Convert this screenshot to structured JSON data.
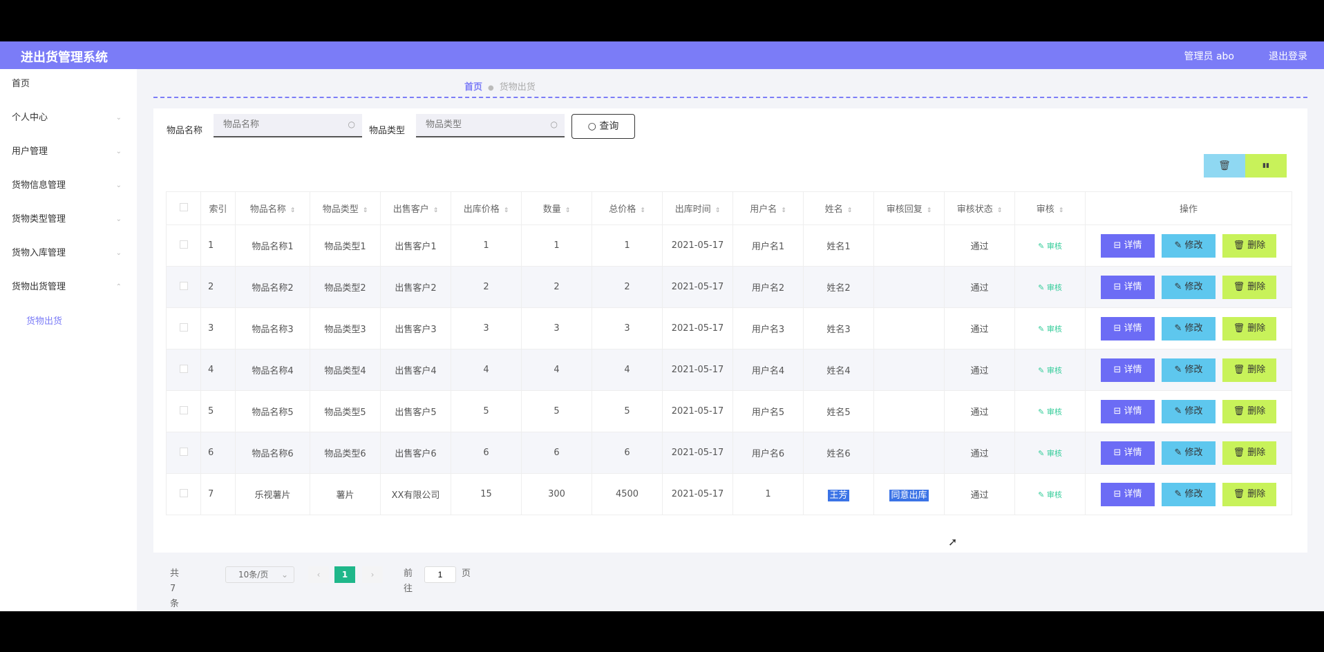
{
  "app": {
    "title": "进出货管理系统",
    "user_label": "管理员 abo",
    "logout_label": "退出登录"
  },
  "sidebar": {
    "items": [
      {
        "label": "首页",
        "chevron": ""
      },
      {
        "label": "个人中心",
        "chevron": "⌄"
      },
      {
        "label": "用户管理",
        "chevron": "⌄"
      },
      {
        "label": "货物信息管理",
        "chevron": "⌄"
      },
      {
        "label": "货物类型管理",
        "chevron": "⌄"
      },
      {
        "label": "货物入库管理",
        "chevron": "⌄"
      },
      {
        "label": "货物出货管理",
        "chevron": "⌃"
      }
    ],
    "sub_item": "货物出货"
  },
  "breadcrumb": {
    "home": "首页",
    "separator": "●",
    "current": "货物出货"
  },
  "search": {
    "name_label": "物品名称",
    "name_placeholder": "物品名称",
    "type_label": "物品类型",
    "type_placeholder": "物品类型",
    "query_label": "查询",
    "query_icon": "search-icon"
  },
  "toolbar": {
    "delete_icon": "🗑",
    "chart_icon": "▮▮"
  },
  "table": {
    "headers": [
      "索引",
      "物品名称",
      "物品类型",
      "出售客户",
      "出库价格",
      "数量",
      "总价格",
      "出库时间",
      "用户名",
      "姓名",
      "审核回复",
      "审核状态",
      "审核",
      "操作"
    ],
    "sort_marker": "⇕",
    "rows": [
      {
        "index": "1",
        "name": "物品名称1",
        "type": "物品类型1",
        "customer": "出售客户1",
        "price": "1",
        "qty": "1",
        "total": "1",
        "date": "2021-05-17",
        "username": "用户名1",
        "realname": "姓名1",
        "reply": "",
        "status": "通过"
      },
      {
        "index": "2",
        "name": "物品名称2",
        "type": "物品类型2",
        "customer": "出售客户2",
        "price": "2",
        "qty": "2",
        "total": "2",
        "date": "2021-05-17",
        "username": "用户名2",
        "realname": "姓名2",
        "reply": "",
        "status": "通过"
      },
      {
        "index": "3",
        "name": "物品名称3",
        "type": "物品类型3",
        "customer": "出售客户3",
        "price": "3",
        "qty": "3",
        "total": "3",
        "date": "2021-05-17",
        "username": "用户名3",
        "realname": "姓名3",
        "reply": "",
        "status": "通过"
      },
      {
        "index": "4",
        "name": "物品名称4",
        "type": "物品类型4",
        "customer": "出售客户4",
        "price": "4",
        "qty": "4",
        "total": "4",
        "date": "2021-05-17",
        "username": "用户名4",
        "realname": "姓名4",
        "reply": "",
        "status": "通过"
      },
      {
        "index": "5",
        "name": "物品名称5",
        "type": "物品类型5",
        "customer": "出售客户5",
        "price": "5",
        "qty": "5",
        "total": "5",
        "date": "2021-05-17",
        "username": "用户名5",
        "realname": "姓名5",
        "reply": "",
        "status": "通过"
      },
      {
        "index": "6",
        "name": "物品名称6",
        "type": "物品类型6",
        "customer": "出售客户6",
        "price": "6",
        "qty": "6",
        "total": "6",
        "date": "2021-05-17",
        "username": "用户名6",
        "realname": "姓名6",
        "reply": "",
        "status": "通过"
      },
      {
        "index": "7",
        "name": "乐视薯片",
        "type": "薯片",
        "customer": "XX有限公司",
        "price": "15",
        "qty": "300",
        "total": "4500",
        "date": "2021-05-17",
        "username": "1",
        "realname": "王芳",
        "reply": "同意出库",
        "status": "通过"
      }
    ],
    "audit_label": "✎ 审核",
    "detail_label": "⊟ 详情",
    "edit_label": "✎ 修改",
    "delete_label": "🗑 删除"
  },
  "pager": {
    "total": "共 7 条",
    "page_size": "10条/页",
    "size_chevron": "⌄",
    "prev": "‹",
    "current": "1",
    "next": "›",
    "goto_prefix": "前往",
    "goto_value": "1",
    "goto_suffix": "页"
  },
  "colors": {
    "accent": "#7b7cf7",
    "detail": "#6c6cf5",
    "edit": "#5ec7ee",
    "delete": "#c8f25a",
    "page_current": "#1fb78a"
  }
}
